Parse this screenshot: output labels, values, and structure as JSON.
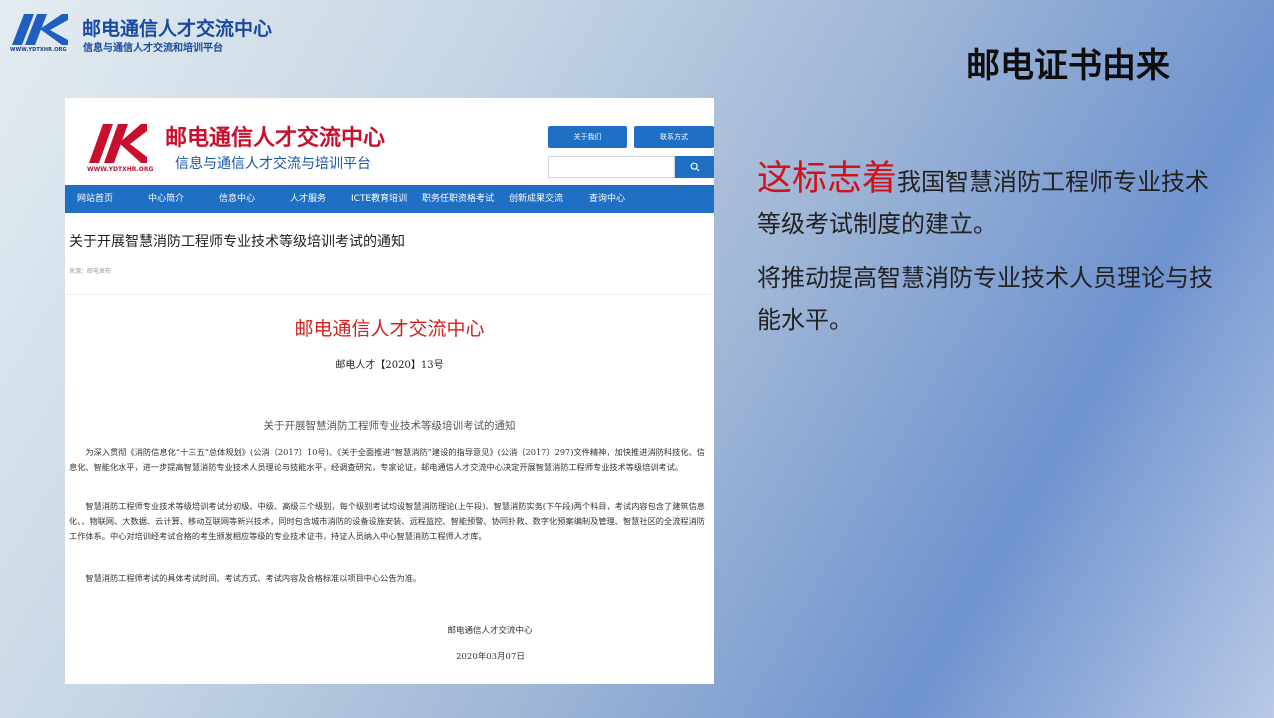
{
  "slide": {
    "logo_url": "WWW.YDTXHR.ORG",
    "brand_title": "邮电通信人才交流中心",
    "brand_subtitle": "信息与通信人才交流和培训平台",
    "title": "邮电证书由来",
    "highlight_text": "这标志着",
    "paragraph1_rest": "我国智慧消防工程师专业技术等级考试制度的建立。",
    "paragraph2": "将推动提高智慧消防专业技术人员理论与技能水平。",
    "accent_color": "#d0121b"
  },
  "website": {
    "logo_url": "WWW.YDTXHR.ORG",
    "title": "邮电通信人才交流中心",
    "subtitle": "信息与通信人才交流与培训平台",
    "about_button": "关于我们",
    "contact_button": "联系方式",
    "nav": [
      "网站首页",
      "中心简介",
      "信息中心",
      "人才服务",
      "ICTE教育培训",
      "职务任职资格考试",
      "创新成果交流",
      "查询中心"
    ],
    "brand_color": "#1f6fc5"
  },
  "article": {
    "title": "关于开展智慧消防工程师专业技术等级培训考试的通知",
    "source": "来源：邮电发布",
    "org_name": "邮电通信人才交流中心",
    "doc_number": "邮电人才【2020】13号",
    "notice_heading": "关于开展智慧消防工程师专业技术等级培训考试的通知",
    "paragraphs": [
      "为深入贯彻《消防信息化“十三五”总体规划》(公消〔2017〕10号)、《关于全面推进“智慧消防”建设的指导意见》(公消〔2017〕297)文件精神，加快推进消防科技化、信息化、智能化水平，进一步提高智慧消防专业技术人员理论与技能水平，经调查研究，专家论证，邮电通信人才交流中心决定开展智慧消防工程师专业技术等级培训考试。",
      "智慧消防工程师专业技术等级培训考试分初级、中级、高级三个级别，每个级别考试均设智慧消防理论(上午段)、智慧消防实务(下午段)两个科目，考试内容包含了建筑信息化、、物联网、大数据、云计算、移动互联网等新兴技术，同时包含城市消防的设备设施安装、远程监控、智能预警、协同扑救、数字化预案编制及管理、智慧社区的全流程消防工作体系。中心对培训经考试合格的考生颁发相应等级的专业技术证书，持证人员纳入中心智慧消防工程师人才库。",
      "智慧消防工程师考试的具体考试时间、考试方式、考试内容及合格标准以项目中心公告为准。"
    ],
    "signature": "邮电通信人才交流中心",
    "date": "2020年03月07日"
  }
}
